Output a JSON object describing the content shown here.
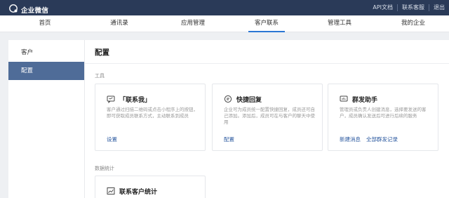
{
  "topbar": {
    "brand": "企业微信",
    "links": [
      "API文档",
      "联系客服",
      "退出"
    ]
  },
  "nav": {
    "items": [
      "首页",
      "通讯录",
      "应用管理",
      "客户联系",
      "管理工具",
      "我的企业"
    ],
    "active_index": 3
  },
  "sidebar": {
    "items": [
      "客户",
      "配置"
    ],
    "active_index": 1
  },
  "main": {
    "title": "配置",
    "tools_label": "工具",
    "stats_label": "数据统计",
    "cards": [
      {
        "icon": "contact-me-icon",
        "title": "「联系我」",
        "desc": "客户通过扫描二维码或点击小程序上的按钮，即可获取成员联系方式，主动联系到成员",
        "links": [
          "设置"
        ]
      },
      {
        "icon": "quick-reply-icon",
        "title": "快捷回复",
        "desc": "企业可为成员统一配置快捷回复，成员还可自己添加。添加后，成员可在与客户的聊天中使用",
        "links": [
          "配置"
        ]
      },
      {
        "icon": "mass-message-icon",
        "title": "群发助手",
        "desc": "管理员或负责人创建消息，选择要发送的客户，成员确认发送后可进行后续的服务",
        "links": [
          "新建消息",
          "全部群发记录"
        ]
      }
    ],
    "stats_card": {
      "icon": "stats-chart-icon",
      "title": "联系客户统计"
    }
  },
  "colors": {
    "topbar_bg": "#2a3a58",
    "accent": "#2c77d4",
    "sidebar_active": "#4f6c98",
    "link": "#2c5aa0"
  }
}
